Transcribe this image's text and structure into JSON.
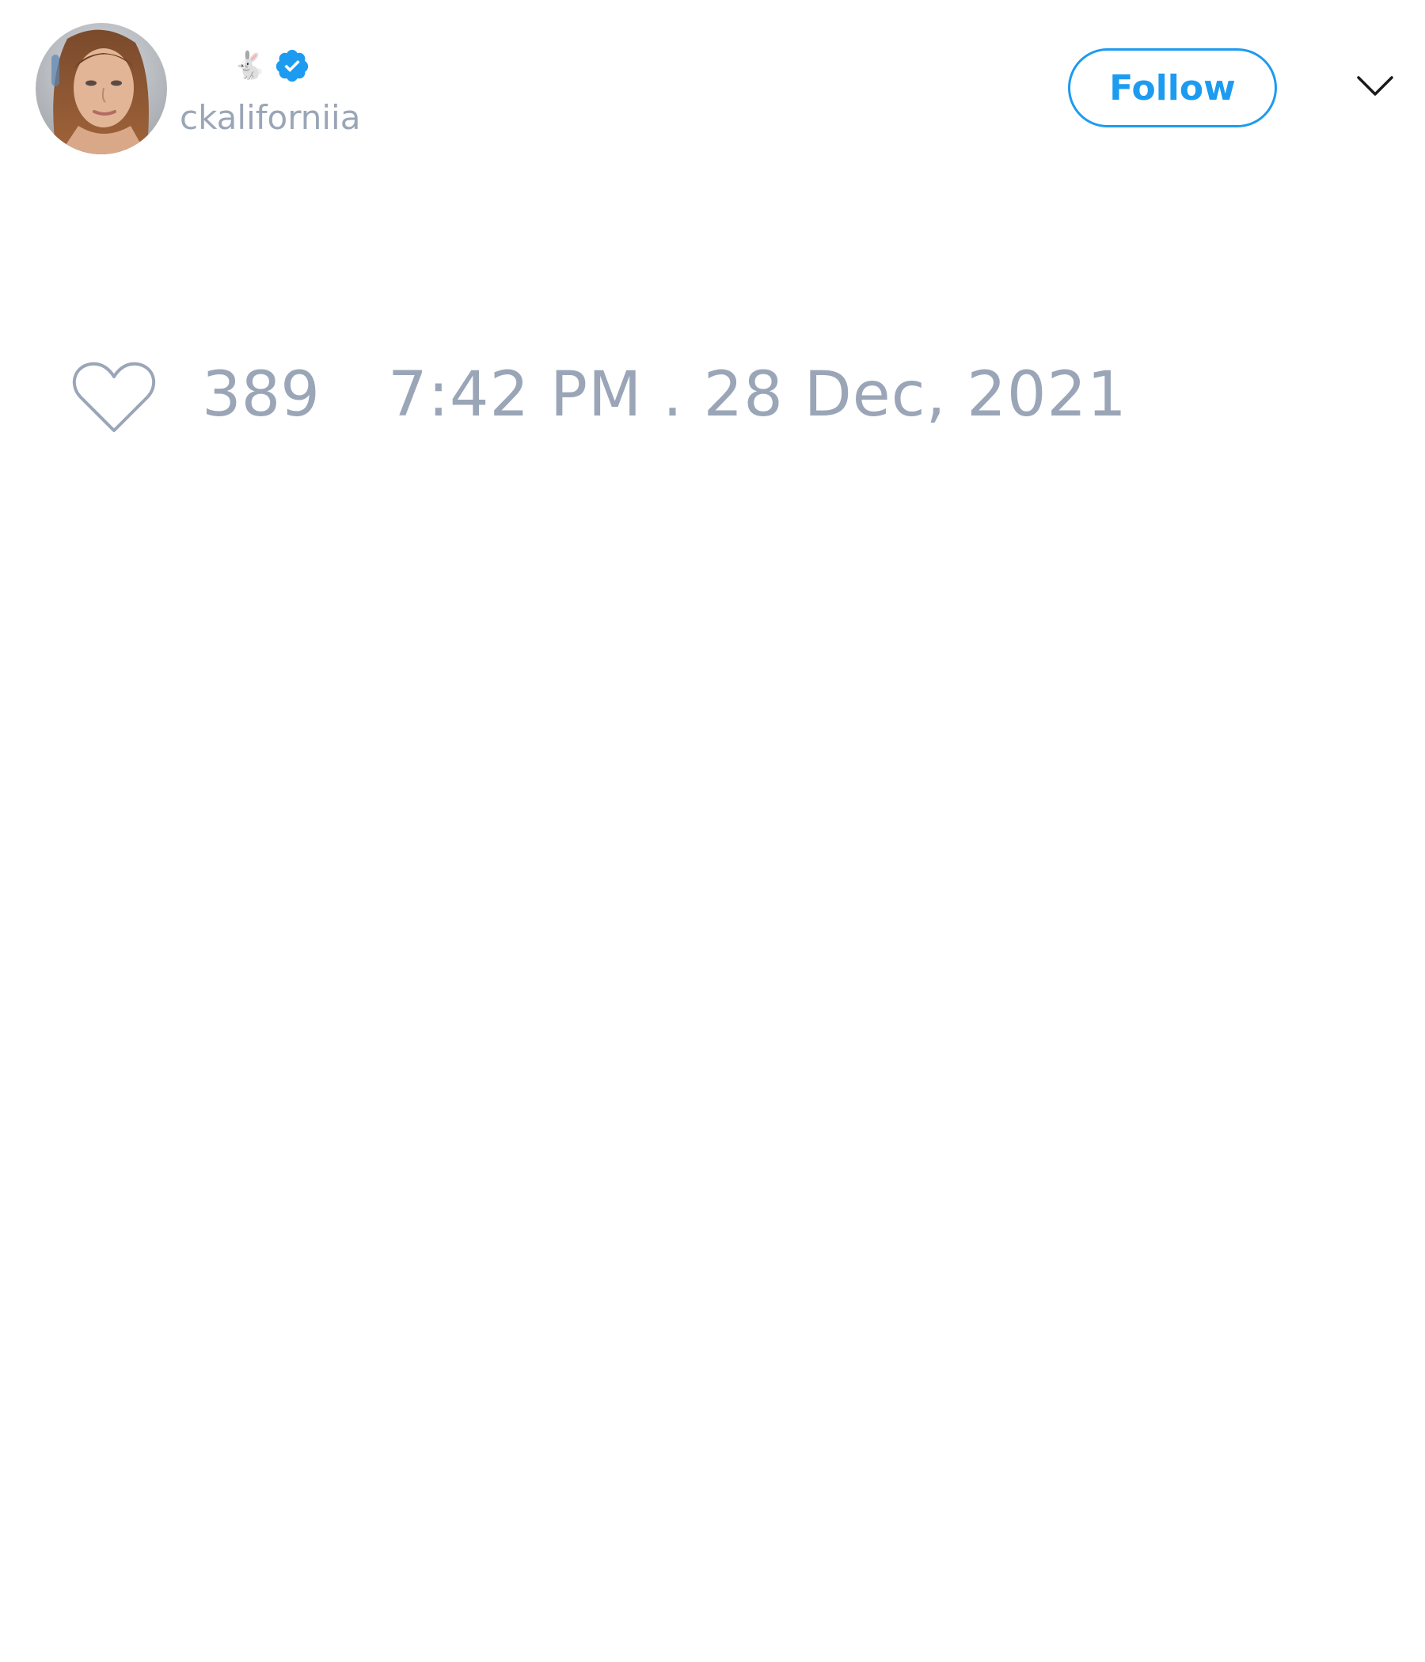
{
  "author": {
    "display_name": "🐇",
    "handle": "ckaliforniia",
    "verified": true
  },
  "icons": {
    "avatar": "profile-photo",
    "verified": "verified-badge-icon",
    "more": "chevron-down-icon",
    "like": "heart-outline-icon"
  },
  "actions": {
    "follow_label": "Follow"
  },
  "tweet": {
    "likes": "389",
    "timestamp": "7:42 PM . 28 Dec, 2021"
  },
  "colors": {
    "accent": "#1d9bf0",
    "muted_text": "#9aa6b7",
    "background": "#ffffff"
  }
}
